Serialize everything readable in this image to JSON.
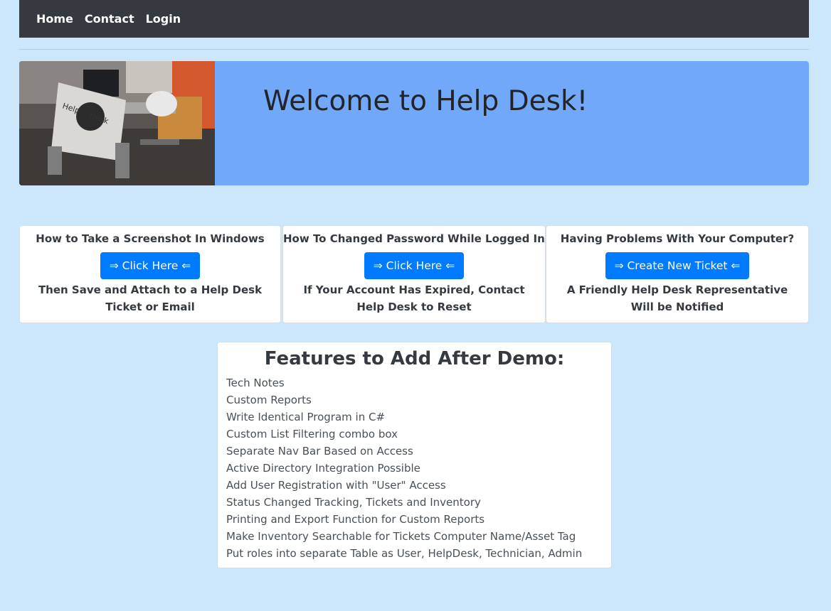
{
  "nav": {
    "home": "Home",
    "contact": "Contact",
    "login": "Login"
  },
  "hero": {
    "title": "Welcome to Help Desk!",
    "image_alt": "Help Desk photo",
    "sign_text_left": "Help",
    "sign_text_right": "Desk"
  },
  "cards": [
    {
      "heading": "How to Take a Screenshot In Windows",
      "button": "⇒ Click Here ⇐",
      "note": "Then Save and Attach to a Help Desk Ticket or Email"
    },
    {
      "heading": "How To Changed Password While Logged In.",
      "button": "⇒ Click Here ⇐",
      "note": "If Your Account Has Expired, Contact Help Desk to Reset"
    },
    {
      "heading": "Having Problems With Your Computer?",
      "button": "⇒ Create New Ticket ⇐",
      "note": "A Friendly Help Desk Representative Will be Notified"
    }
  ],
  "features": {
    "title": "Features to Add After Demo:",
    "items": [
      "Tech Notes",
      "Custom Reports",
      "Write Identical Program in C#",
      "Custom List Filtering combo box",
      "Separate Nav Bar Based on Access",
      "Active Directory Integration Possible",
      "Add User Registration with \"User\" Access",
      "Status Changed Tracking, Tickets and Inventory",
      "Printing and Export Function for Custom Reports",
      "Make Inventory Searchable for Tickets Computer Name/Asset Tag",
      "Put roles into separate Table as User, HelpDesk, Technician, Admin"
    ]
  },
  "colors": {
    "page_bg": "#cce7fb",
    "navbar_bg": "#343a40",
    "jumbotron_bg": "#72a8fa",
    "button_bg": "#007bff"
  }
}
